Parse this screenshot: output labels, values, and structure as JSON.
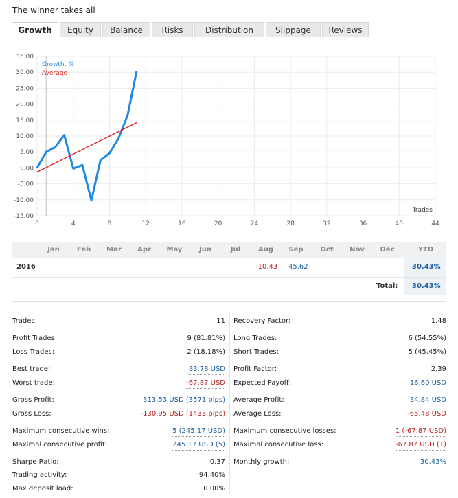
{
  "title": "The winner takes all",
  "tabs": [
    "Growth",
    "Equity",
    "Balance",
    "Risks",
    "Distribution",
    "Slippage",
    "Reviews"
  ],
  "active_tab": "Growth",
  "chart_data": {
    "type": "line",
    "ylim": [
      -15,
      35
    ],
    "xlim": [
      0,
      44
    ],
    "x_ticks": [
      0,
      4,
      8,
      12,
      16,
      20,
      24,
      28,
      32,
      36,
      40,
      44
    ],
    "y_ticks": [
      "35.00",
      "30.00",
      "25.00",
      "20.00",
      "15.00",
      "10.00",
      "5.00",
      "0.00",
      "-5.00",
      "-10.00",
      "-15.00"
    ],
    "xlabel": "Trades",
    "legend": [
      "Growth, %",
      "Average"
    ],
    "series": [
      {
        "name": "Growth, %",
        "color": "#1e88e5",
        "x": [
          0,
          1,
          2,
          3,
          4,
          5,
          6,
          7,
          8,
          9,
          10,
          11
        ],
        "y": [
          0,
          5.0,
          6.5,
          10.3,
          -0.2,
          0.9,
          -10.2,
          2.4,
          4.6,
          9.3,
          16.5,
          30.4
        ]
      },
      {
        "name": "Average",
        "color": "#e02020",
        "x": [
          0,
          11
        ],
        "y": [
          -1.3,
          14.2
        ]
      }
    ],
    "grid": true
  },
  "monthly": {
    "months": [
      "Jan",
      "Feb",
      "Mar",
      "Apr",
      "May",
      "Jun",
      "Jul",
      "Aug",
      "Sep",
      "Oct",
      "Nov",
      "Dec"
    ],
    "ytd_header": "YTD",
    "year": "2016",
    "aug": "-10.43",
    "sep": "45.62",
    "ytd": "30.43%",
    "total_label": "Total:",
    "total": "30.43%"
  },
  "stats_left": [
    {
      "label": "Trades:",
      "value": "11"
    },
    {
      "label": "Profit Trades:",
      "value": "9 (81.81%)"
    },
    {
      "label": "Loss Trades:",
      "value": "2 (18.18%)"
    },
    {
      "label": "Best trade:",
      "value": "83.78 USD"
    },
    {
      "label": "Worst trade:",
      "value": "-67.87 USD"
    },
    {
      "label": "Gross Profit:",
      "value": "313.53 USD (3571 pips)"
    },
    {
      "label": "Gross Loss:",
      "value": "-130.95 USD (1433 pips)"
    },
    {
      "label": "Maximum consecutive wins:",
      "value": "5 (245.17 USD)"
    },
    {
      "label": "Maximal consecutive profit:",
      "value": "245.17 USD (5)"
    },
    {
      "label": "Sharpe Ratio:",
      "value": "0.37"
    },
    {
      "label": "Trading activity:",
      "value": "94.40%"
    },
    {
      "label": "Max deposit load:",
      "value": "0.00%"
    }
  ],
  "stats_right": [
    {
      "label": "Recovery Factor:",
      "value": "1.48"
    },
    {
      "label": "Long Trades:",
      "value": "6 (54.55%)"
    },
    {
      "label": "Short Trades:",
      "value": "5 (45.45%)"
    },
    {
      "label": "Profit Factor:",
      "value": "2.39"
    },
    {
      "label": "Expected Payoff:",
      "value": "16.60 USD"
    },
    {
      "label": "Average Profit:",
      "value": "34.84 USD"
    },
    {
      "label": "Average Loss:",
      "value": "-65.48 USD"
    },
    {
      "label": "Maximum consecutive losses:",
      "value": "1 (-67.87 USD)"
    },
    {
      "label": "Maximal consecutive loss:",
      "value": "-67.87 USD (1)"
    },
    {
      "label": "Monthly growth:",
      "value": "30.43%"
    }
  ]
}
